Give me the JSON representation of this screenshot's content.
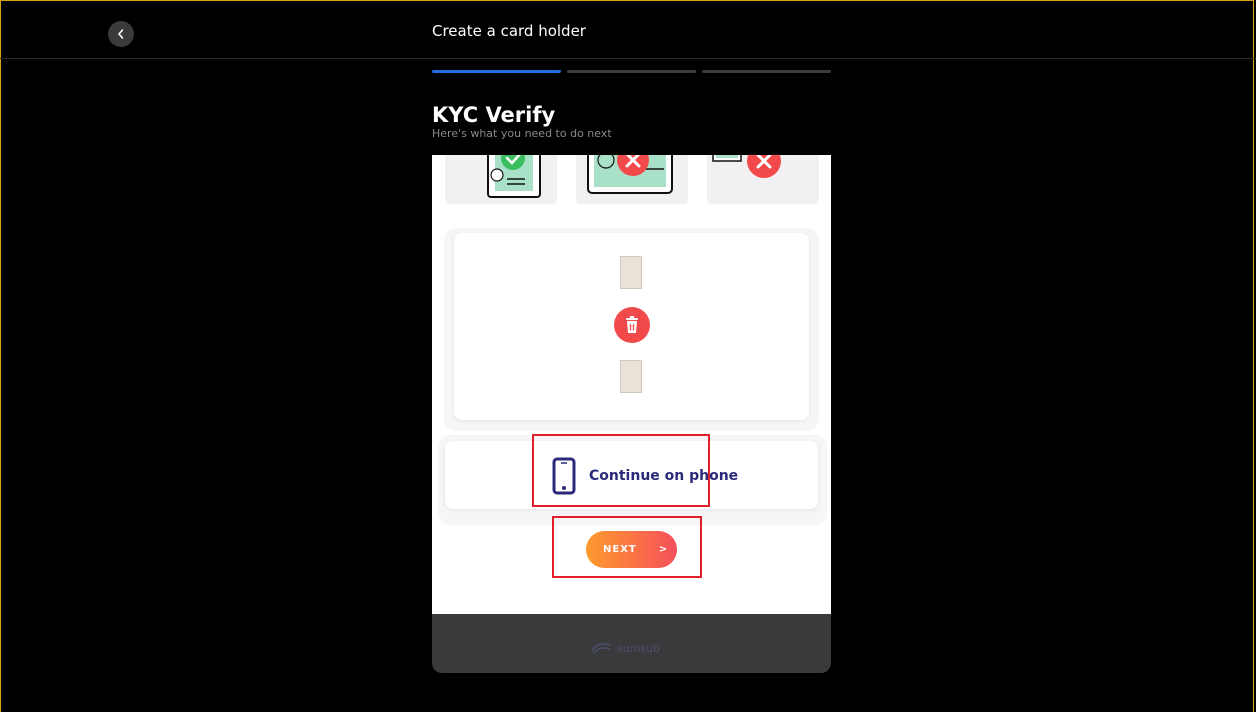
{
  "header": {
    "title": "Create a card holder"
  },
  "steps": {
    "total": 3,
    "current": 1
  },
  "kyc": {
    "title": "KYC Verify",
    "subtitle": "Here's what you need to do next"
  },
  "continue_phone": {
    "label": "Continue on phone"
  },
  "next_button": {
    "label": "NEXT",
    "chevron": ">"
  },
  "footer": {
    "brand": "sumsub"
  },
  "colors": {
    "accent_blue": "#1f6fe0",
    "frame_border": "#d8a018",
    "highlight": "#e0202a",
    "delete_red": "#f24a4a",
    "phone_text": "#2a2a7a",
    "next_gradient_start": "#ff9a2e",
    "next_gradient_end": "#f5505a"
  },
  "icons": {
    "back": "chevron-left-icon",
    "check": "check-icon",
    "cross": "x-icon",
    "trash": "trash-icon",
    "phone": "phone-icon"
  }
}
